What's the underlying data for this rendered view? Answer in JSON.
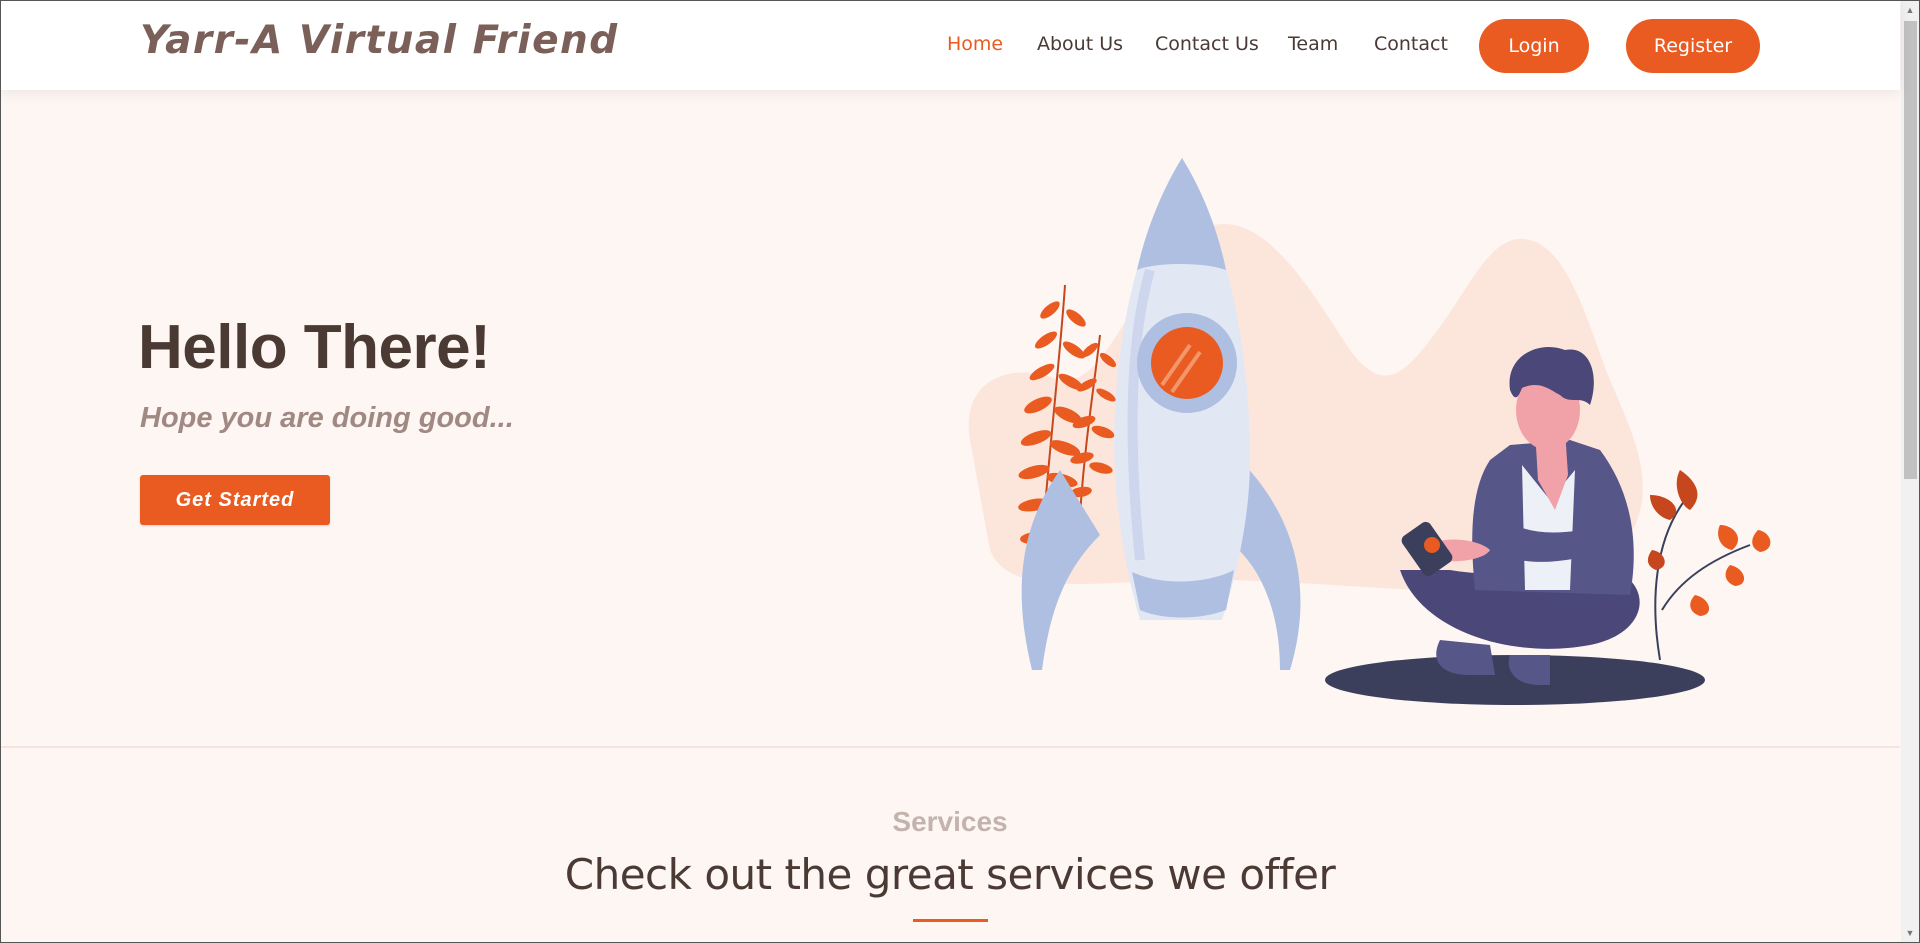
{
  "header": {
    "logo": "Yarr-A Virtual Friend",
    "nav": [
      "Home",
      "About Us",
      "Contact Us",
      "Team",
      "Contact"
    ],
    "login_label": "Login",
    "register_label": "Register"
  },
  "hero": {
    "title": "Hello There!",
    "subtitle": "Hope you are doing good...",
    "cta_label": "Get Started"
  },
  "services": {
    "eyebrow": "Services",
    "title": "Check out the great services we offer"
  },
  "colors": {
    "accent": "#e95b21",
    "background": "#fdf6f2",
    "heading": "#4b3a34",
    "logo": "#7a6058"
  }
}
